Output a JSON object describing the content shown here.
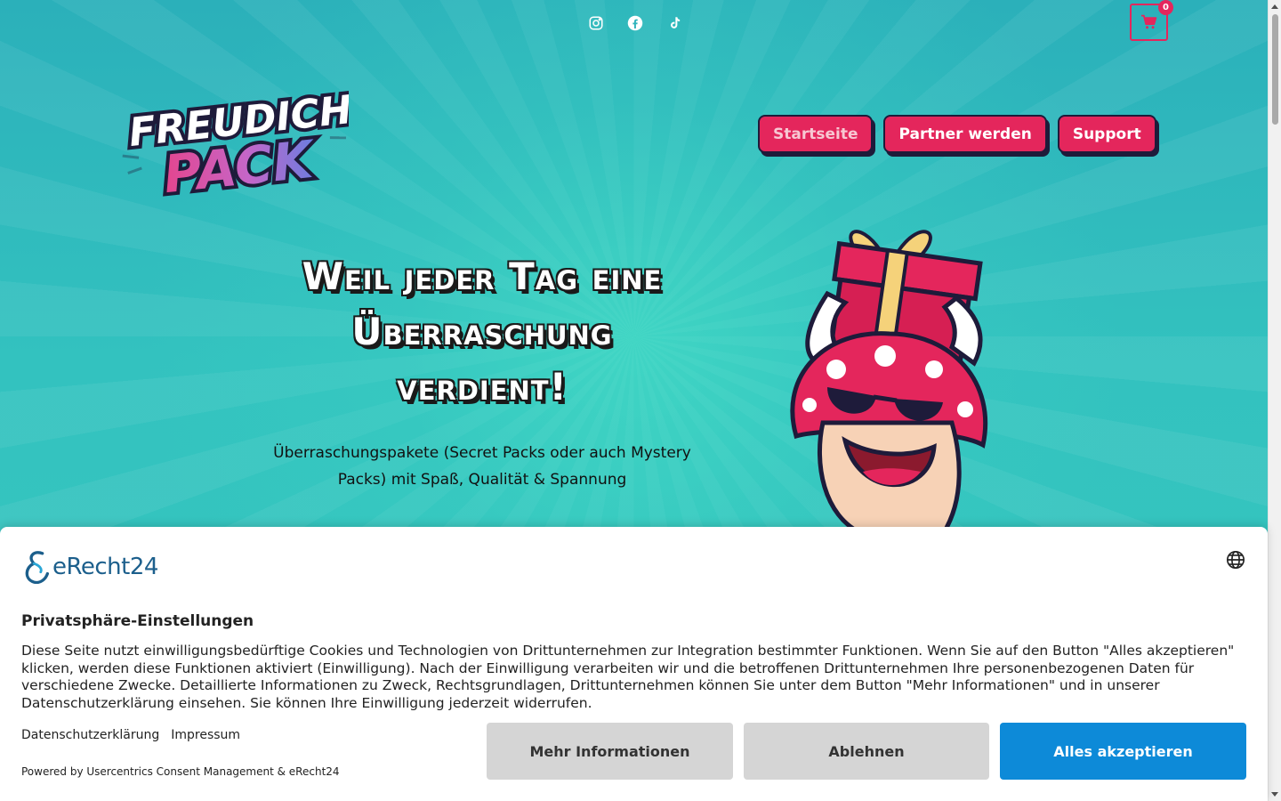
{
  "topbar": {
    "socials": [
      {
        "name": "instagram-icon"
      },
      {
        "name": "facebook-icon"
      },
      {
        "name": "tiktok-icon"
      }
    ],
    "cart_count": "0"
  },
  "logo": {
    "line1": "FREUDICH",
    "line2": "PACK"
  },
  "nav": {
    "items": [
      {
        "label": "Startseite"
      },
      {
        "label": "Partner werden"
      },
      {
        "label": "Support"
      }
    ]
  },
  "hero": {
    "headline_line1": "Weil jeder Tag eine",
    "headline_line2": "Überraschung",
    "headline_line3": "verdient!",
    "subline": "Überraschungspakete (Secret Packs oder auch Mystery Packs) mit Spaß, Qualität & Spannung"
  },
  "consent": {
    "brand": "eRecht24",
    "title": "Privatsphäre-Einstellungen",
    "text": "Diese Seite nutzt einwilligungsbedürftige Cookies und Technologien von Drittunternehmen zur Integration bestimmter Funktionen. Wenn Sie auf den Button \"Alles akzeptieren\" klicken, werden diese Funktionen aktiviert (Einwilligung). Nach der Einwilligung verarbeiten wir und die betroffenen Drittunternehmen Ihre personenbezogenen Daten für verschiedene Zwecke. Detaillierte Informationen zu Zweck, Rechtsgrundlagen, Drittunternehmen können Sie unter dem Button \"Mehr Informationen\" und in unserer Datenschutzerklärung einsehen. Sie können Ihre Einwilligung jederzeit widerrufen.",
    "link_privacy": "Datenschutzerklärung",
    "link_imprint": "Impressum",
    "powered": "Powered by Usercentrics Consent Management & eRecht24",
    "btn_more": "Mehr Informationen",
    "btn_deny": "Ablehnen",
    "btn_accept": "Alles akzeptieren"
  },
  "colors": {
    "accent": "#e4265c",
    "hero_bg": "#33c2bf",
    "accept": "#0d8ad8"
  }
}
